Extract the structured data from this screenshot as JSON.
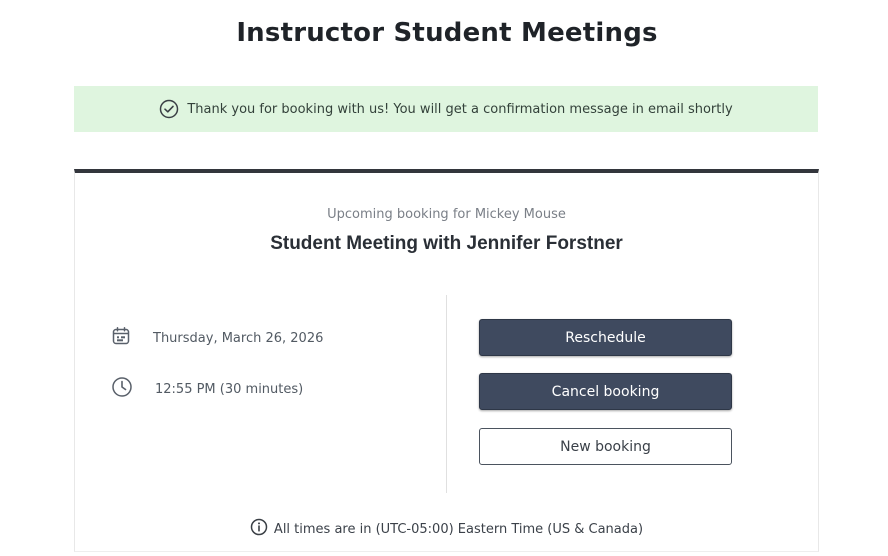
{
  "page": {
    "title": "Instructor Student Meetings"
  },
  "banner": {
    "icon": "check-circle-icon",
    "message": "Thank you for booking with us! You will get a confirmation message in email shortly",
    "color": "#dff5df"
  },
  "booking": {
    "subtitle": "Upcoming booking for Mickey Mouse",
    "title": "Student Meeting with Jennifer Forstner",
    "date": {
      "icon": "calendar-icon",
      "text": "Thursday, March 26, 2026"
    },
    "time": {
      "icon": "clock-icon",
      "text": "12:55 PM (30 minutes)"
    }
  },
  "actions": {
    "reschedule_label": "Reschedule",
    "cancel_label": "Cancel booking",
    "new_booking_label": "New booking",
    "primary_color": "#3f4a5f"
  },
  "footer": {
    "icon": "info-icon",
    "timezone_text": "All times are in (UTC-05:00) Eastern Time (US & Canada)"
  }
}
